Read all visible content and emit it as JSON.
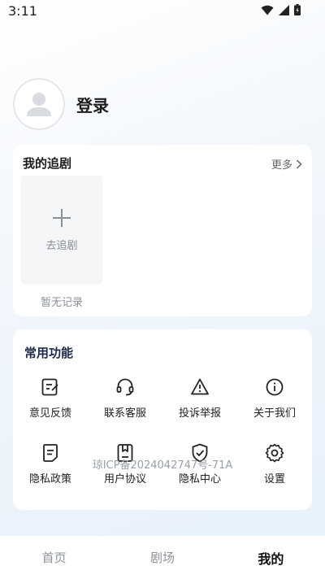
{
  "status_bar": {
    "time": "3:11"
  },
  "profile": {
    "login_label": "登录"
  },
  "follow_card": {
    "title": "我的追剧",
    "more_label": "更多",
    "add_label": "去追剧",
    "empty_label": "暂无记录"
  },
  "functions_card": {
    "title": "常用功能",
    "items": [
      {
        "label": "意见反馈",
        "icon": "feedback-icon"
      },
      {
        "label": "联系客服",
        "icon": "headset-icon"
      },
      {
        "label": "投诉举报",
        "icon": "warning-icon"
      },
      {
        "label": "关于我们",
        "icon": "info-icon"
      },
      {
        "label": "隐私政策",
        "icon": "document-icon"
      },
      {
        "label": "用户协议",
        "icon": "agreement-icon"
      },
      {
        "label": "隐私中心",
        "icon": "shield-check-icon"
      },
      {
        "label": "设置",
        "icon": "gear-icon"
      }
    ]
  },
  "icp": "琼ICP备2024042747号-71A",
  "tabs": [
    {
      "label": "首页",
      "active": false
    },
    {
      "label": "剧场",
      "active": false
    },
    {
      "label": "我的",
      "active": true
    }
  ]
}
